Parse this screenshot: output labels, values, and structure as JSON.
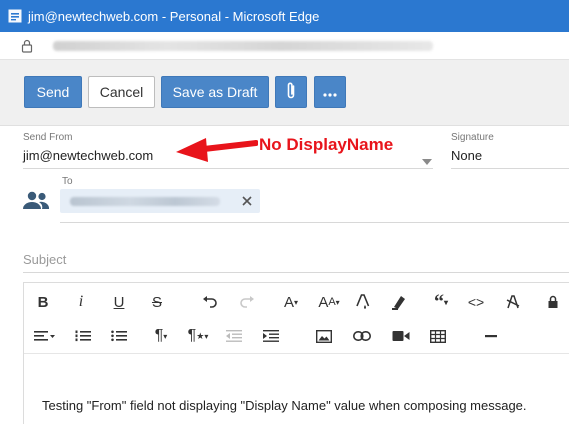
{
  "window": {
    "title": "jim@newtechweb.com - Personal - Microsoft Edge"
  },
  "toolbar": {
    "send_label": "Send",
    "cancel_label": "Cancel",
    "save_draft_label": "Save as Draft",
    "attach_icon": "paperclip-icon",
    "more_icon": "ellipsis-icon",
    "accent_color": "#4a86c8"
  },
  "send_from": {
    "label": "Send From",
    "value": "jim@newtechweb.com"
  },
  "signature": {
    "label": "Signature",
    "value": "None"
  },
  "to": {
    "label": "To"
  },
  "subject": {
    "placeholder": "Subject"
  },
  "annotation": {
    "text": "No DisplayName",
    "color": "#e8141b"
  },
  "editor": {
    "body_text": "Testing \"From\" field not displaying \"Display Name\" value when composing message.",
    "format_buttons_row1": [
      "bold",
      "italic",
      "underline",
      "strikethrough",
      "undo",
      "redo",
      "font-family",
      "font-size",
      "text-color",
      "highlight",
      "quote",
      "code",
      "clear-format",
      "lock"
    ],
    "format_buttons_row2": [
      "align",
      "ordered-list",
      "unordered-list",
      "paragraph-format",
      "paragraph-style",
      "outdent",
      "indent",
      "image",
      "link",
      "video",
      "table",
      "horizontal-rule"
    ]
  }
}
